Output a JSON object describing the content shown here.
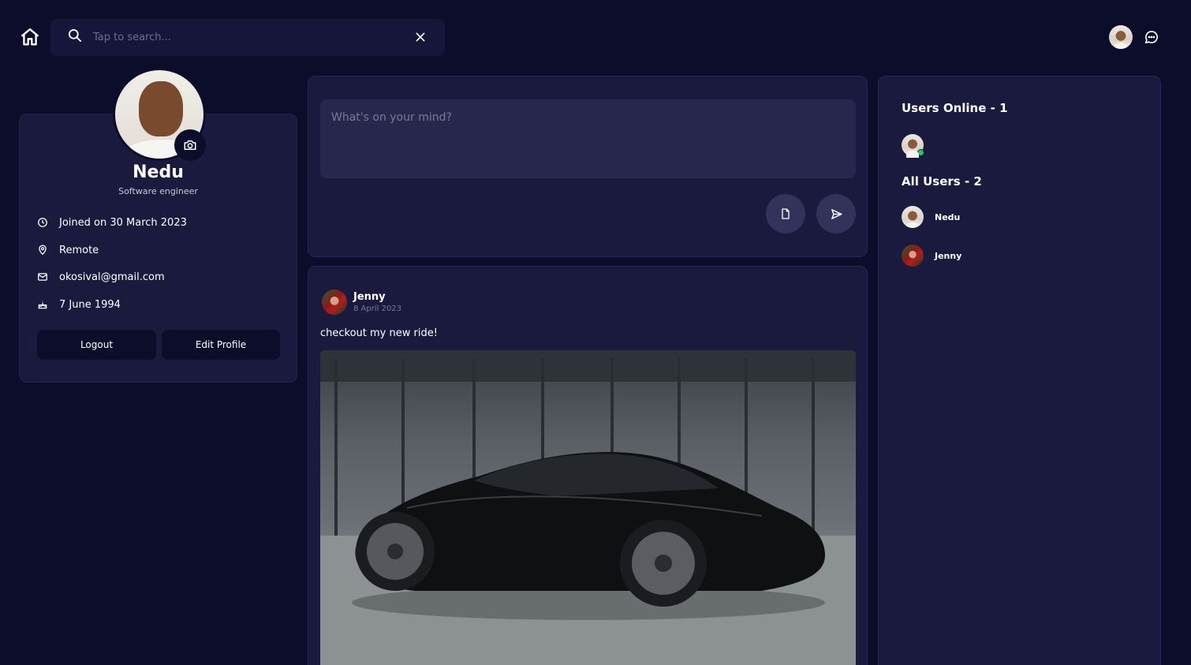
{
  "header": {
    "search_placeholder": "Tap to search..."
  },
  "profile": {
    "name": "Nedu",
    "role": "Software engineer",
    "joined": "Joined on 30 March 2023",
    "location": "Remote",
    "email": "okosival@gmail.com",
    "birthday": "7 June 1994",
    "logout_label": "Logout",
    "edit_label": "Edit Profile"
  },
  "composer": {
    "placeholder": "What's on your mind?"
  },
  "post": {
    "author": "Jenny",
    "date": "8 April 2023",
    "text": "checkout my new ride!"
  },
  "sidebar": {
    "online_title": "Users Online - 1",
    "all_title": "All Users - 2",
    "users": [
      {
        "name": "Nedu"
      },
      {
        "name": "Jenny"
      }
    ]
  },
  "colors": {
    "background": "#0c0c2b",
    "card": "#1a1a3e",
    "online": "#22c55e"
  }
}
